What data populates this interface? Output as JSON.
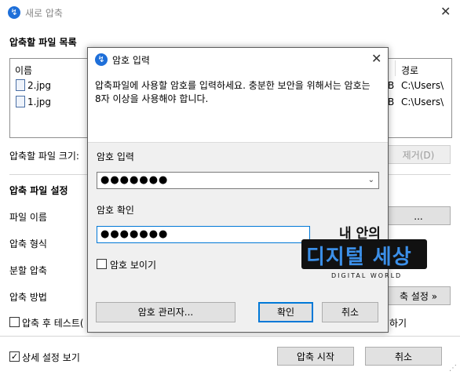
{
  "main": {
    "title": "새로 압축",
    "file_list_label": "압축할 파일 목록",
    "columns": {
      "name": "이름",
      "path": "경로"
    },
    "files": [
      {
        "name": "2.jpg",
        "size_tail": "B",
        "path": "C:\\Users\\"
      },
      {
        "name": "1.jpg",
        "size_tail": "B",
        "path": "C:\\Users\\"
      }
    ],
    "file_size_label": "압축할 파일 크기:",
    "remove_button": "제거(D)",
    "settings_heading": "압축 파일 설정",
    "rows": {
      "file_name": "파일 이름",
      "format": "압축 형식",
      "split": "분할 압축",
      "method": "압축 방법"
    },
    "browse_button": "...",
    "method_settings_button": "축 설정 »",
    "test_after_label": "압축 후 테스트(",
    "right_tail_label": "하기",
    "detail_view_label": "상세 설정 보기",
    "start_button": "압축 시작",
    "cancel_button": "취소"
  },
  "dialog": {
    "title": "암호 입력",
    "description": "압축파일에 사용할 암호를 입력하세요. 충분한 보안을 위해서는 암호는 8자 이상을 사용해야 합니다.",
    "password_label": "암호 입력",
    "password_value": "●●●●●●●",
    "confirm_label": "암호 확인",
    "confirm_value": "●●●●●●●",
    "show_password_label": "암호 보이기",
    "manager_button": "암호 관리자...",
    "ok_button": "확인",
    "cancel_button": "취소"
  },
  "watermark": {
    "line1": "내 안의",
    "line2": "디지털 세상",
    "line3": "DIGITAL WORLD"
  },
  "colors": {
    "accent": "#0078d7",
    "app_icon": "#1e6fd9",
    "watermark_blue": "#3b8fe8"
  }
}
